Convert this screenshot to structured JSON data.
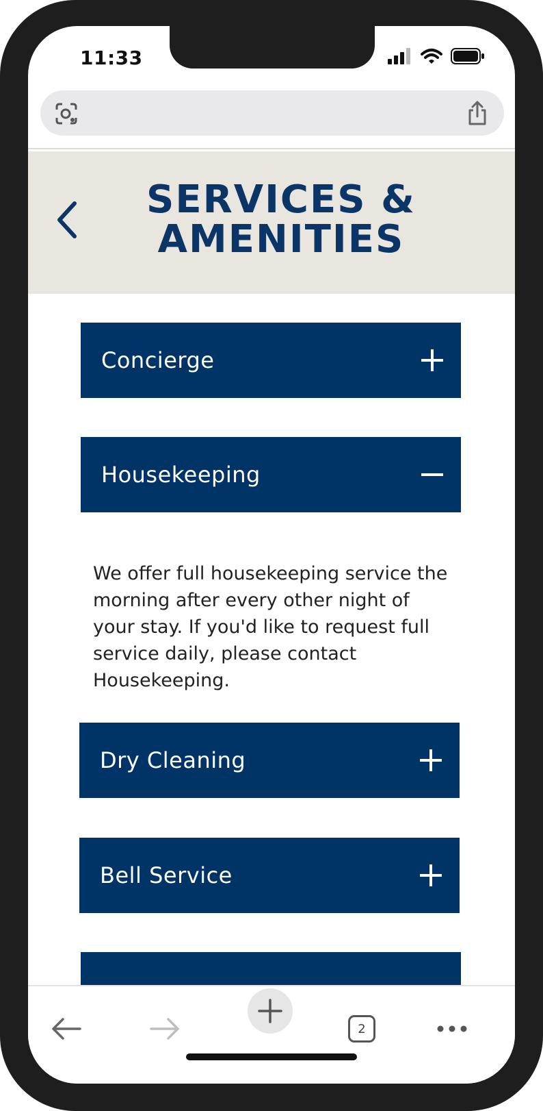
{
  "status_bar": {
    "time": "11:33",
    "icons": [
      "signal-icon",
      "wifi-icon",
      "battery-icon"
    ]
  },
  "address_bar": {
    "left_icon": "lens-icon",
    "right_icon": "share-icon"
  },
  "header": {
    "back_icon": "chevron-left-icon",
    "title_line1": "SERVICES &",
    "title_line2": "AMENITIES"
  },
  "accordion": {
    "items": [
      {
        "label": "Concierge",
        "state": "collapsed",
        "toggle": "plus-icon"
      },
      {
        "label": "Housekeeping",
        "state": "expanded",
        "toggle": "minus-icon",
        "body": "We offer full housekeeping service the morning after every other night of your stay. If you'd like to request full service daily, please contact Housekeeping."
      },
      {
        "label": "Dry Cleaning",
        "state": "collapsed",
        "toggle": "plus-icon"
      },
      {
        "label": "Bell Service",
        "state": "collapsed",
        "toggle": "plus-icon"
      },
      {
        "label": "",
        "state": "collapsed",
        "toggle": ""
      }
    ]
  },
  "toolbar": {
    "back_icon": "arrow-left-icon",
    "forward_icon": "arrow-right-icon",
    "new_tab_icon": "plus-icon",
    "tabs_count": "2",
    "more_icon": "more-icon"
  },
  "colors": {
    "accent": "#003366",
    "title": "#0b3567",
    "header_bg": "#e9e6e0"
  }
}
